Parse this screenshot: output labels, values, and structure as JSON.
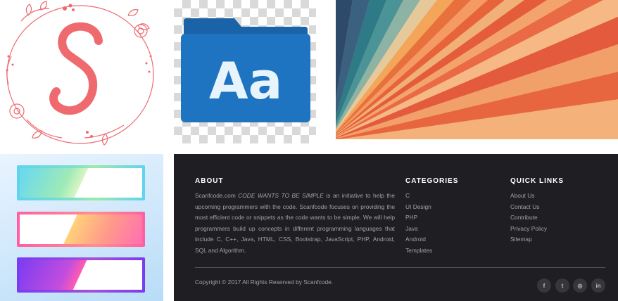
{
  "tiles": {
    "monogram": {
      "letter": "S",
      "color": "#ef6a6f"
    },
    "folder": {
      "text": "Aa",
      "color": "#1e74c1"
    },
    "banners": {
      "colors": [
        "#5fd3f0",
        "#ff6fb0",
        "#7b3df2"
      ]
    }
  },
  "footer": {
    "about": {
      "title": "ABOUT",
      "text_prefix": "Scanfcode.com ",
      "text_italic": "CODE WANTS TO BE SIMPLE",
      "text_suffix": " is an initiative to help the upcoming programmers with the code. Scanfcode focuses on providing the most efficient code or snippets as the code wants to be simple. We will help programmers build up concepts in different programming languages that include C, C++, Java, HTML, CSS, Bootstrap, JavaScript, PHP, Android, SQL and Algorithm."
    },
    "categories": {
      "title": "CATEGORIES",
      "items": [
        "C",
        "UI Design",
        "PHP",
        "Java",
        "Android",
        "Templates"
      ]
    },
    "quick_links": {
      "title": "QUICK LINKS",
      "items": [
        "About Us",
        "Contact Us",
        "Contribute",
        "Privacy Policy",
        "Sitemap"
      ]
    },
    "copyright": "Copyright © 2017 All Rights Reserved by Scanfcode.",
    "social": [
      {
        "icon": "facebook-icon",
        "glyph": "f"
      },
      {
        "icon": "twitter-icon",
        "glyph": "t"
      },
      {
        "icon": "dribbble-icon",
        "glyph": "◎"
      },
      {
        "icon": "linkedin-icon",
        "glyph": "in"
      }
    ]
  }
}
